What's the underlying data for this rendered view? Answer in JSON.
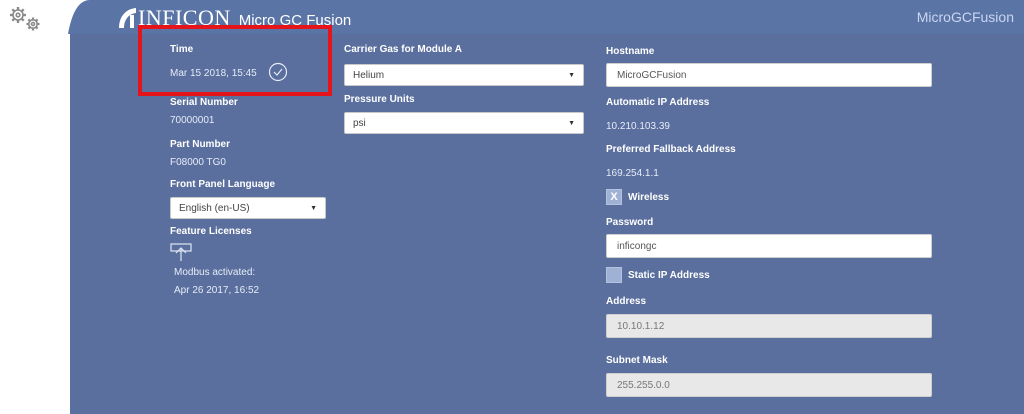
{
  "header": {
    "brand": "INFICON",
    "product": "Micro GC Fusion",
    "hostname_display": "MicroGCFusion"
  },
  "col1": {
    "time_label": "Time",
    "time_value": "Mar 15 2018, 15:45",
    "serial_label": "Serial Number",
    "serial_value": "70000001",
    "part_label": "Part Number",
    "part_value": "F08000 TG0",
    "language_label": "Front Panel Language",
    "language_value": "English (en-US)",
    "licenses_label": "Feature Licenses",
    "license_line1": "Modbus activated:",
    "license_line2": "Apr 26 2017, 16:52"
  },
  "col2": {
    "carrier_label": "Carrier Gas for Module A",
    "carrier_value": "Helium",
    "pressure_label": "Pressure Units",
    "pressure_value": "psi"
  },
  "col3": {
    "hostname_label": "Hostname",
    "hostname_value": "MicroGCFusion",
    "auto_ip_label": "Automatic IP Address",
    "auto_ip_value": "10.210.103.39",
    "fallback_label": "Preferred Fallback Address",
    "fallback_value": "169.254.1.1",
    "wireless_check": "X",
    "wireless_label": "Wireless",
    "password_label": "Password",
    "password_value": "inficongc",
    "static_ip_label": "Static IP Address",
    "address_label": "Address",
    "address_value": "10.10.1.12",
    "subnet_label": "Subnet Mask",
    "subnet_value": "255.255.0.0"
  },
  "colors": {
    "header": "#5b74a6",
    "panel": "#5a6f9e",
    "highlight": "#e5141b"
  }
}
